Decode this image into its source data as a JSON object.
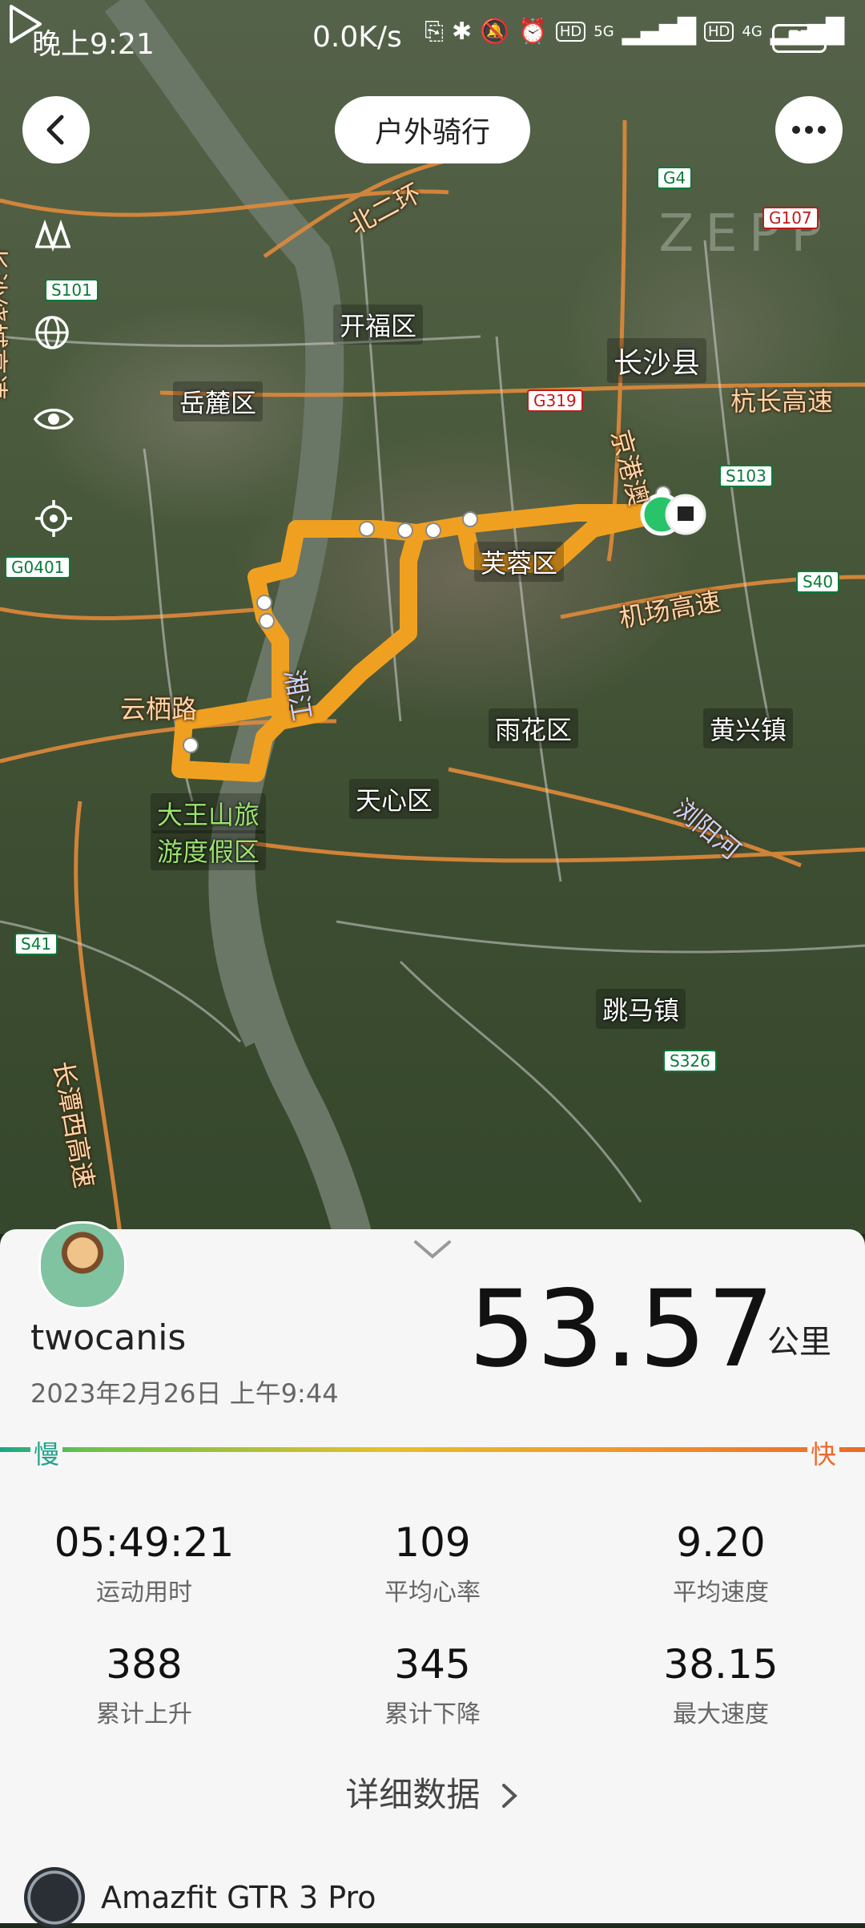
{
  "status_bar": {
    "time": "晚上9:21",
    "net_speed": "0.0K/s",
    "signal_1": "5G",
    "signal_2": "4G",
    "battery": "77"
  },
  "header": {
    "title": "户外骑行",
    "back_icon": "chevron-left-icon",
    "more_icon": "more-dots-icon"
  },
  "map": {
    "watermark": "ZEPP",
    "tools": [
      "layers-icon",
      "globe-icon",
      "eye-icon",
      "locate-icon"
    ],
    "labels": {
      "kaifu": "开福区",
      "yuelu": "岳麓区",
      "changsha_county": "长沙县",
      "furong": "芙蓉区",
      "yuhua": "雨花区",
      "tianxin": "天心区",
      "huangxing": "黄兴镇",
      "tiaoma": "跳马镇",
      "dawang_1": "大王山旅",
      "dawang_2": "游度假区"
    },
    "roads": {
      "beierhuan": "北二环",
      "hangchang": "杭长高速",
      "jichang": "机场高速",
      "yunqi": "云栖路",
      "jinggangao": "京港澳",
      "changtan": "长潭西高速",
      "liuyang": "浏阳河",
      "xiang": "湘江",
      "changshaluo": "长沙绕城高速"
    },
    "shields": {
      "g4": "G4",
      "g107": "G107",
      "s101": "S101",
      "g319": "G319",
      "s103": "S103",
      "g0401": "G0401",
      "s40": "S40",
      "s41": "S41",
      "s326": "S326"
    }
  },
  "activity": {
    "username": "twocanis",
    "datetime": "2023年2月26日 上午9:44",
    "distance": "53.57",
    "distance_unit": "公里",
    "pace_slow": "慢",
    "pace_fast": "快",
    "stats": [
      {
        "value": "05:49:21",
        "label": "运动用时"
      },
      {
        "value": "109",
        "label": "平均心率"
      },
      {
        "value": "9.20",
        "label": "平均速度"
      },
      {
        "value": "388",
        "label": "累计上升"
      },
      {
        "value": "345",
        "label": "累计下降"
      },
      {
        "value": "38.15",
        "label": "最大速度"
      }
    ],
    "details_label": "详细数据",
    "device": "Amazfit GTR 3 Pro"
  }
}
